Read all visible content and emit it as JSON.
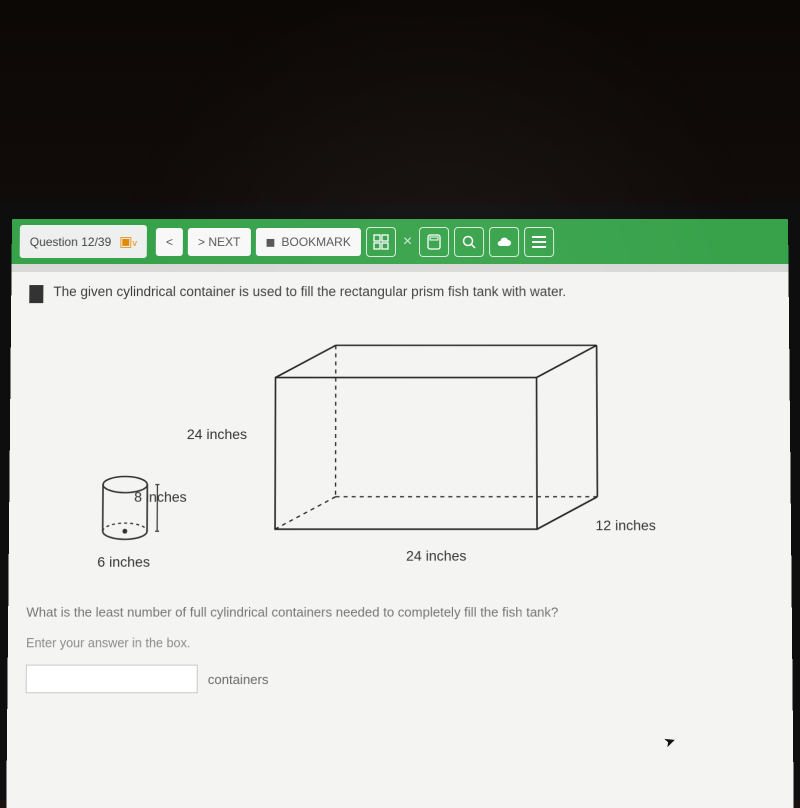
{
  "toolbar": {
    "question_counter": "Question 12/39",
    "prev_label": "<",
    "next_label": ">  NEXT",
    "bookmark_label": "BOOKMARK"
  },
  "question": {
    "stem": "The given cylindrical container is used to fill the rectangular prism fish tank with water.",
    "cylinder": {
      "height_label": "8 inches",
      "diameter_label": "6 inches"
    },
    "prism": {
      "height_label": "24 inches",
      "width_label": "24 inches",
      "depth_label": "12 inches"
    },
    "prompt_least": "What is the least number of full cylindrical containers needed to completely fill the fish tank?",
    "enter_hint": "Enter your answer in the box.",
    "unit": "containers",
    "answer_value": ""
  }
}
